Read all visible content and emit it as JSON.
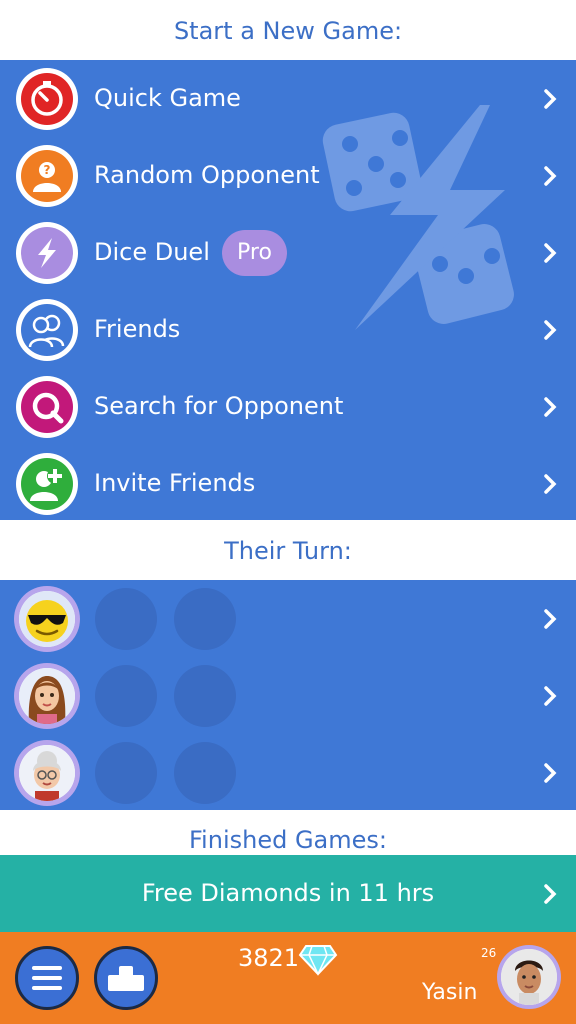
{
  "sections": {
    "new_game": "Start a New Game:",
    "their_turn": "Their Turn:",
    "finished": "Finished Games:"
  },
  "menu": {
    "items": [
      {
        "label": "Quick Game",
        "icon": "stopwatch-icon",
        "color": "#e02525"
      },
      {
        "label": "Random Opponent",
        "icon": "mystery-person-icon",
        "color": "#f07d22"
      },
      {
        "label": "Dice Duel",
        "icon": "lightning-icon",
        "color": "#a98de0",
        "badge": "Pro"
      },
      {
        "label": "Friends",
        "icon": "friends-icon",
        "color": "#3f78d6"
      },
      {
        "label": "Search for Opponent",
        "icon": "search-icon",
        "color": "#c2187a"
      },
      {
        "label": "Invite Friends",
        "icon": "add-person-icon",
        "color": "#2fae3c"
      }
    ]
  },
  "turns": [
    {
      "avatar": "sunglasses-smiley-avatar"
    },
    {
      "avatar": "woman-cartoon-avatar"
    },
    {
      "avatar": "grandma-cartoon-avatar"
    }
  ],
  "promo": {
    "label": "Free Diamonds in 11 hrs"
  },
  "footer": {
    "coins": "3821",
    "level": "26",
    "username": "Yasin"
  },
  "colors": {
    "panel_blue": "#3f78d6",
    "header_text": "#3c6fc6",
    "promo_teal": "#25b1a5",
    "footer_orange": "#f07d22",
    "pro_purple": "#a98de0"
  }
}
